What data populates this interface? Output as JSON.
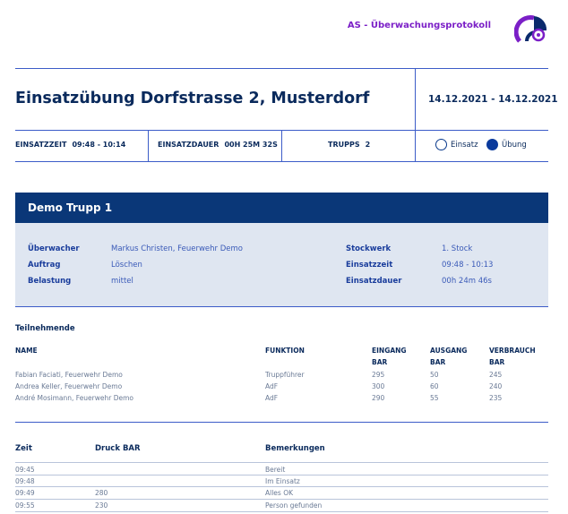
{
  "header": {
    "brand": "AS - Überwachungsprotokoll"
  },
  "icons": {
    "logo": "brand-logo"
  },
  "colors": {
    "primary": "#0a3778",
    "accent": "#7b1fc7",
    "panel": "#dfe6f1"
  },
  "event": {
    "title": "Einsatzübung Dorfstrasse 2, Musterdorf",
    "dates": "14.12.2021 - 14.12.2021",
    "einsatzzeit_label": "EINSATZZEIT",
    "einsatzzeit": "09:48 - 10:14",
    "einsatzdauer_label": "EINSATZDAUER",
    "einsatzdauer": "00h 25m 32s",
    "trupps_label": "TRUPPS",
    "trupps": "2",
    "einsatz_label": "Einsatz",
    "uebung_label": "Übung",
    "selected": "Übung"
  },
  "trupp": {
    "name": "Demo Trupp 1",
    "ueberwacher_label": "Überwacher",
    "ueberwacher": "Markus Christen, Feuerwehr Demo",
    "auftrag_label": "Auftrag",
    "auftrag": "Löschen",
    "belastung_label": "Belastung",
    "belastung": "mittel",
    "stockwerk_label": "Stockwerk",
    "stockwerk": "1. Stock",
    "einsatzzeit_label": "Einsatzzeit",
    "einsatzzeit": "09:48 - 10:13",
    "einsatzdauer_label": "Einsatzdauer",
    "einsatzdauer": "00h 24m 46s"
  },
  "participants": {
    "title": "Teilnehmende",
    "headers": {
      "name": "NAME",
      "funktion": "FUNKTION",
      "eingang_1": "EINGANG",
      "eingang_2": "BAR",
      "ausgang_1": "AUSGANG",
      "ausgang_2": "BAR",
      "verbrauch_1": "VERBRAUCH",
      "verbrauch_2": "BAR"
    },
    "rows": [
      {
        "name": "Fabian Faciati, Feuerwehr Demo",
        "funktion": "Truppführer",
        "eingang": "295",
        "ausgang": "50",
        "verbrauch": "245"
      },
      {
        "name": "Andrea Keller, Feuerwehr Demo",
        "funktion": "AdF",
        "eingang": "300",
        "ausgang": "60",
        "verbrauch": "240"
      },
      {
        "name": "André Mosimann, Feuerwehr Demo",
        "funktion": "AdF",
        "eingang": "290",
        "ausgang": "55",
        "verbrauch": "235"
      }
    ]
  },
  "log": {
    "headers": {
      "zeit": "Zeit",
      "druck": "Druck BAR",
      "bemerkungen": "Bemerkungen"
    },
    "rows": [
      {
        "zeit": "09:45",
        "druck": "",
        "bemerkung": "Bereit"
      },
      {
        "zeit": "09:48",
        "druck": "",
        "bemerkung": "Im Einsatz"
      },
      {
        "zeit": "09:49",
        "druck": "280",
        "bemerkung": "Alles OK"
      },
      {
        "zeit": "09:55",
        "druck": "230",
        "bemerkung": "Person gefunden"
      }
    ]
  }
}
